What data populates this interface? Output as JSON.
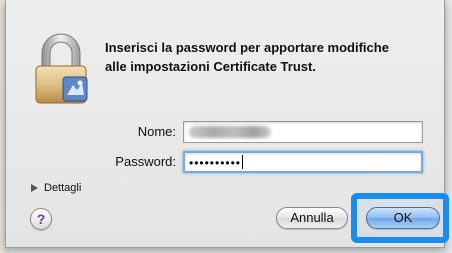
{
  "dialog": {
    "message_line1": "Inserisci la password per apportare modifiche",
    "message_line2": "alle impostazioni Certificate Trust."
  },
  "form": {
    "name_label": "Nome:",
    "password_label": "Password:",
    "password_value": "••••••••••"
  },
  "details_label": "Dettagli",
  "help_label": "?",
  "buttons": {
    "cancel": "Annulla",
    "ok": "OK"
  },
  "icons": {
    "lock": "padlock-icon",
    "help": "question-mark-icon",
    "disclosure": "disclosure-triangle-icon"
  },
  "colors": {
    "focus_highlight": "#1a8cf0",
    "default_button": "#8fbdf0"
  }
}
